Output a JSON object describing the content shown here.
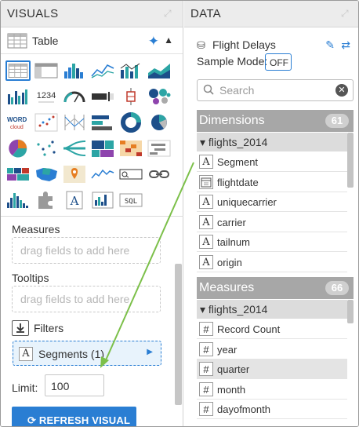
{
  "visuals": {
    "title": "VISUALS",
    "table_label": "Table",
    "measures_label": "Measures",
    "measures_placeholder": "drag fields to add here",
    "tooltips_label": "Tooltips",
    "tooltips_placeholder": "drag fields to add here",
    "filters_label": "Filters",
    "segment_pill": "Segments (1)",
    "limit_label": "Limit:",
    "limit_value": "100",
    "refresh_label": "REFRESH VISUAL",
    "gallery_icons": [
      "table-chart-icon",
      "crosstab-icon",
      "bars-icon",
      "lines-icon",
      "combo-icon",
      "areas-icon",
      "grouped-bars-icon",
      "kpi-icon",
      "gauge-icon",
      "bullet-icon",
      "box-plot-icon",
      "packed-bubbles-icon",
      "word-cloud-icon",
      "scatter-icon",
      "parallel-icon",
      "horizontal-bars-icon",
      "donut-icon",
      "pie-icon",
      "radial-icon",
      "network-icon",
      "sankey-icon",
      "treemap-icon",
      "heatmap-icon",
      "interval-icon",
      "choropleth-icon",
      "us-map-icon",
      "map-pin-icon",
      "sparklines-icon",
      "search-filter-icon",
      "chain-link-icon",
      "histogram-icon",
      "extension-icon",
      "rich-text-icon",
      "correlation-icon",
      "sql-icon"
    ],
    "kpi_text": "1234",
    "word_cloud_text": "WORD",
    "sql_text": "SQL",
    "accent_color": "#2a7ed3"
  },
  "data": {
    "title": "DATA",
    "dataset_name": "Flight Delays",
    "sample_mode_label": "Sample Mode:",
    "sample_mode_value": "OFF",
    "search_placeholder": "Search",
    "dimensions": {
      "label": "Dimensions",
      "count": "61",
      "group": "flights_2014",
      "fields": [
        {
          "name": "Segment",
          "icon": "A"
        },
        {
          "name": "flightdate",
          "icon": "calendar"
        },
        {
          "name": "uniquecarrier",
          "icon": "A"
        },
        {
          "name": "carrier",
          "icon": "A"
        },
        {
          "name": "tailnum",
          "icon": "A"
        },
        {
          "name": "origin",
          "icon": "A"
        }
      ]
    },
    "measures": {
      "label": "Measures",
      "count": "66",
      "group": "flights_2014",
      "fields": [
        {
          "name": "Record Count",
          "icon": "#"
        },
        {
          "name": "year",
          "icon": "#"
        },
        {
          "name": "quarter",
          "icon": "#"
        },
        {
          "name": "month",
          "icon": "#"
        },
        {
          "name": "dayofmonth",
          "icon": "#"
        }
      ]
    }
  }
}
